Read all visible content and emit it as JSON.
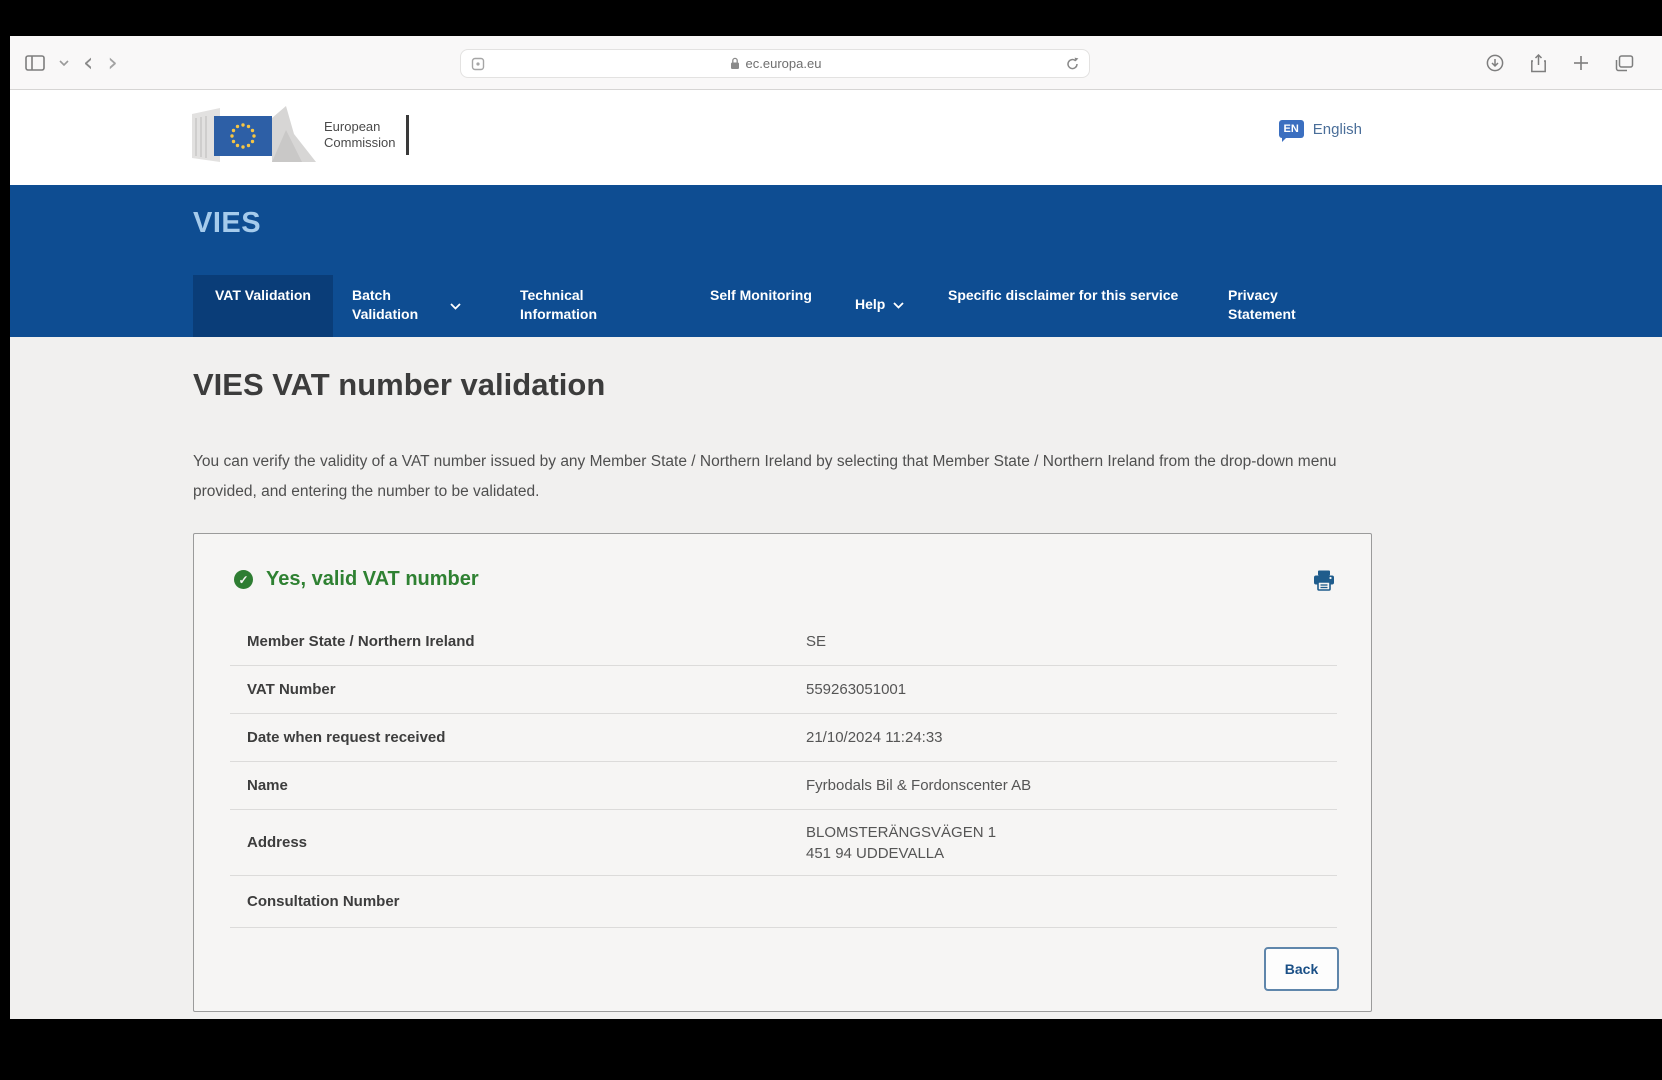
{
  "browser": {
    "url": "ec.europa.eu"
  },
  "header": {
    "logo": {
      "line1": "European",
      "line2": "Commission"
    },
    "language": {
      "badge": "EN",
      "label": "English"
    }
  },
  "siteband": {
    "brand": "VIES",
    "nav": [
      {
        "label": "VAT Validation",
        "active": true
      },
      {
        "label": "Batch Validation",
        "dropdown": true
      },
      {
        "label": "Technical Information"
      },
      {
        "label": "Self Monitoring"
      },
      {
        "label": "Help",
        "dropdown": true
      },
      {
        "label": "Specific disclaimer for this service"
      },
      {
        "label": "Privacy Statement"
      }
    ]
  },
  "main": {
    "title": "VIES VAT number validation",
    "intro": "You can verify the validity of a VAT number issued by any Member State / Northern Ireland by selecting that Member State / Northern Ireland from the drop-down menu provided, and entering the number to be validated.",
    "result": {
      "status": "Yes, valid VAT number",
      "check_mark": "✓",
      "rows": [
        {
          "label": "Member State / Northern Ireland",
          "value": "SE"
        },
        {
          "label": "VAT Number",
          "value": "559263051001"
        },
        {
          "label": "Date when request received",
          "value": "21/10/2024 11:24:33"
        },
        {
          "label": "Name",
          "value": "Fyrbodals Bil & Fordonscenter AB"
        },
        {
          "label": "Address",
          "value": "BLOMSTERÄNGSVÄGEN 1\n451 94 UDDEVALLA"
        },
        {
          "label": "Consultation Number",
          "value": ""
        }
      ],
      "back_label": "Back"
    }
  },
  "colors": {
    "band_blue": "#0e4d92",
    "active_tab_blue": "#0a3d78",
    "brand_light_blue": "#a5cbec",
    "valid_green": "#2e7d32",
    "accent_blue": "#1f5c8c",
    "flag_blue": "#2d5fa6",
    "star_yellow": "#f6c544"
  }
}
